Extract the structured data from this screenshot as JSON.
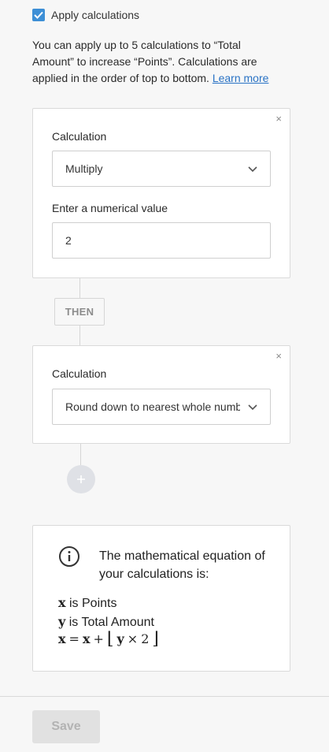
{
  "apply": {
    "label": "Apply calculations",
    "checked": true
  },
  "intro": {
    "text": "You can apply up to 5 calculations to “Total Amount” to increase “Points”. Calculations are applied in the order of top to bottom.",
    "link": "Learn more"
  },
  "calc1": {
    "close": "×",
    "label": "Calculation",
    "value": "Multiply",
    "num_label": "Enter a numerical value",
    "num_value": "2"
  },
  "then_label": "THEN",
  "calc2": {
    "close": "×",
    "label": "Calculation",
    "value": "Round down to nearest whole number"
  },
  "add_symbol": "+",
  "info": {
    "title": "The mathematical equation of your calculations is:",
    "x_var": "x",
    "x_desc": "is Points",
    "y_var": "y",
    "y_desc": "is Total Amount",
    "formula": {
      "lhs": "x",
      "eq": "=",
      "x": "x",
      "plus": "+",
      "floor_open": "⌊",
      "y": "y",
      "times": "×",
      "num": "2",
      "floor_close": "⌋"
    }
  },
  "footer": {
    "save_label": "Save"
  },
  "colors": {
    "accent": "#3d8fd6",
    "link": "#2a73c5"
  }
}
